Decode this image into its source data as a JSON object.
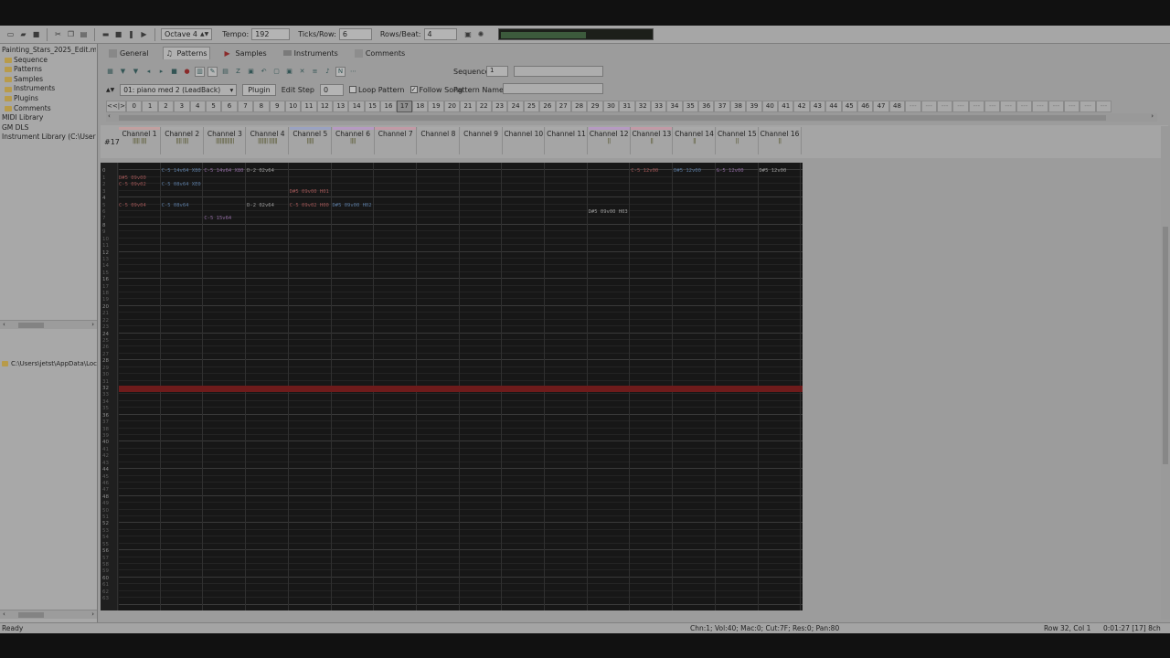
{
  "toolbar": {
    "octave": "Octave 4",
    "tempo_label": "Tempo:",
    "tempo_value": "192",
    "ticks_label": "Ticks/Row:",
    "ticks_value": "6",
    "rpb_label": "Rows/Beat:",
    "rpb_value": "4",
    "vu_level": 0.56,
    "vu_color": "#3c5a3c"
  },
  "sidebar": {
    "root": "Painting_Stars_2025_Edit.mptm",
    "items": [
      {
        "label": "Sequence"
      },
      {
        "label": "Patterns"
      },
      {
        "label": "Samples"
      },
      {
        "label": "Instruments"
      },
      {
        "label": "Plugins"
      },
      {
        "label": "Comments"
      }
    ],
    "midi_library": "MIDI Library",
    "gm_dls": "GM DLS",
    "instrument_library": "Instrument Library (C:\\Users\\jetst",
    "browser_path": "C:\\Users\\jetst\\AppData\\Loc"
  },
  "tabs": [
    {
      "label": "General"
    },
    {
      "label": "Patterns"
    },
    {
      "label": "Samples"
    },
    {
      "label": "Instruments"
    },
    {
      "label": "Comments"
    }
  ],
  "pattern_toolbar": {
    "sequence_label": "Sequence",
    "sequence_value": "1",
    "instrument": "01: piano med 2 (LeadBack)",
    "plugin_label": "Plugin",
    "edit_step_label": "Edit Step",
    "edit_step_value": "0",
    "loop_pattern": "Loop Pattern",
    "follow_song": "Follow Song",
    "pattern_name_label": "Pattern Name"
  },
  "orders": {
    "nav": "<<|>>",
    "selected": 17,
    "items": [
      "0",
      "1",
      "2",
      "3",
      "4",
      "5",
      "6",
      "7",
      "8",
      "9",
      "10",
      "11",
      "12",
      "13",
      "14",
      "15",
      "16",
      "17",
      "18",
      "19",
      "20",
      "21",
      "22",
      "23",
      "24",
      "25",
      "26",
      "27",
      "28",
      "29",
      "30",
      "31",
      "32",
      "33",
      "34",
      "35",
      "36",
      "37",
      "38",
      "39",
      "40",
      "41",
      "42",
      "43",
      "44",
      "45",
      "46",
      "47",
      "48",
      "---",
      "---",
      "---",
      "---",
      "---",
      "---",
      "---",
      "---",
      "---",
      "---",
      "---",
      "---",
      "---"
    ]
  },
  "pattern": {
    "number": "#17",
    "channels": [
      {
        "name": "Channel 1",
        "vol": "||||| ||||",
        "color": "#c2a0a0"
      },
      {
        "name": "Channel 2",
        "vol": "|||| ||||",
        "color": "#a9a9a9"
      },
      {
        "name": "Channel 3",
        "vol": "|||||||||||||",
        "color": "#a9a9a9"
      },
      {
        "name": "Channel 4",
        "vol": "||||||| ||||||",
        "color": "#a9a9a9"
      },
      {
        "name": "Channel 5",
        "vol": "|||||",
        "color": "#9aa2c2"
      },
      {
        "name": "Channel 6",
        "vol": "||||",
        "color": "#b69ac2"
      },
      {
        "name": "Channel 7",
        "vol": "",
        "color": "#c29aa6"
      },
      {
        "name": "Channel 8",
        "vol": "",
        "color": "#a9a9a9"
      },
      {
        "name": "Channel 9",
        "vol": "",
        "color": "#a9a9a9"
      },
      {
        "name": "Channel 10",
        "vol": "",
        "color": "#a9a9a9"
      },
      {
        "name": "Channel 11",
        "vol": "",
        "color": "#a9a9a9"
      },
      {
        "name": "Channel 12",
        "vol": "||",
        "color": "#b69ac2"
      },
      {
        "name": "Channel 13",
        "vol": "||",
        "color": "#c29aa6"
      },
      {
        "name": "Channel 14",
        "vol": "||",
        "color": "#a9a9a9"
      },
      {
        "name": "Channel 15",
        "vol": "||",
        "color": "#a9a9a9"
      },
      {
        "name": "Channel 16",
        "vol": "||",
        "color": "#a9a9a9"
      }
    ],
    "row_count": 64,
    "play_row": 32,
    "sample_notes": [
      {
        "ch": 0,
        "row": 1,
        "text": "D#5 09v00"
      },
      {
        "ch": 0,
        "row": 2,
        "text": "C-5 09v02"
      },
      {
        "ch": 0,
        "row": 5,
        "text": "C-5 09v04"
      },
      {
        "ch": 1,
        "row": 0,
        "text": "C-5 14v64 X80"
      },
      {
        "ch": 1,
        "row": 2,
        "text": "C-5 08v64 XE0"
      },
      {
        "ch": 1,
        "row": 5,
        "text": "C-5 08v64"
      },
      {
        "ch": 2,
        "row": 0,
        "text": "C-5 14v64 X80"
      },
      {
        "ch": 2,
        "row": 7,
        "text": "C-5 15v64"
      },
      {
        "ch": 3,
        "row": 0,
        "text": "D-2 02v64"
      },
      {
        "ch": 3,
        "row": 5,
        "text": "D-2 02v64"
      },
      {
        "ch": 4,
        "row": 3,
        "text": "D#5 09v00 H01"
      },
      {
        "ch": 4,
        "row": 5,
        "text": "C-5 09v02 H00"
      },
      {
        "ch": 5,
        "row": 5,
        "text": "D#5 09v00 H02"
      },
      {
        "ch": 11,
        "row": 6,
        "text": "D#5 09v00 H03"
      },
      {
        "ch": 12,
        "row": 0,
        "text": "C-5 12v00"
      },
      {
        "ch": 13,
        "row": 0,
        "text": "D#5 12v00"
      },
      {
        "ch": 14,
        "row": 0,
        "text": "G-5 12v00"
      },
      {
        "ch": 15,
        "row": 0,
        "text": "D#5 12v00"
      }
    ]
  },
  "status": {
    "ready": "Ready",
    "info": "Chn:1; Vol:40; Mac:0; Cut:7F; Res:0; Pan:80",
    "position": "Row 32, Col 1",
    "time": "0:01:27 [17] 8ch"
  }
}
